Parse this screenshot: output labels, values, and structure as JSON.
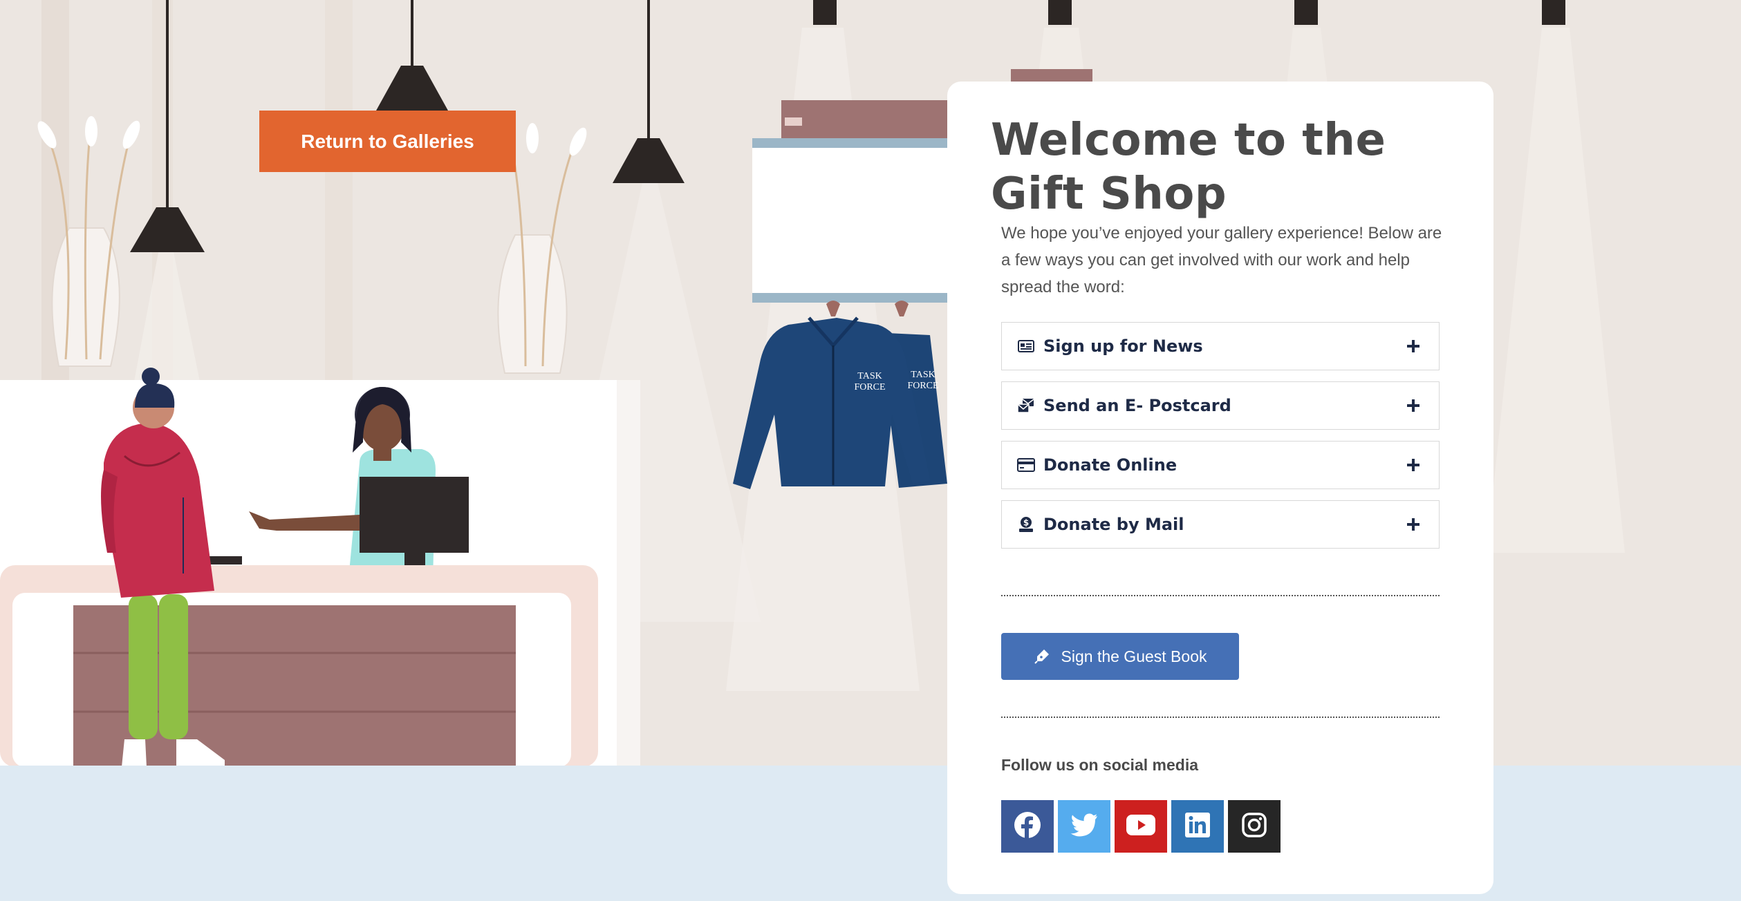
{
  "return_button": {
    "label": "Return to Galleries"
  },
  "panel": {
    "title_line1": "Welcome to the",
    "title_line2": "Gift Shop",
    "intro": "We hope you’ve enjoyed your gallery experience! Below are a few ways you can get involved with our work and help spread the word:",
    "accordion": [
      {
        "label": "Sign up for News",
        "icon": "newspaper-icon"
      },
      {
        "label": "Send an E- Postcard",
        "icon": "envelope-icon"
      },
      {
        "label": "Donate Online",
        "icon": "credit-card-icon"
      },
      {
        "label": "Donate by Mail",
        "icon": "donate-icon"
      }
    ],
    "guest_book_label": "Sign the Guest Book",
    "follow_label": "Follow us on social media",
    "social": [
      {
        "name": "facebook",
        "color": "#3b5998"
      },
      {
        "name": "twitter",
        "color": "#55acee"
      },
      {
        "name": "youtube",
        "color": "#cd201f"
      },
      {
        "name": "linkedin",
        "color": "#0077b5"
      },
      {
        "name": "instagram",
        "color": "#262626"
      }
    ]
  },
  "illustration": {
    "jacket_logo_line1": "TASK",
    "jacket_logo_line2": "FORCE"
  },
  "colors": {
    "accent_orange": "#e2652f",
    "button_blue": "#4570b6",
    "heading": "#4a4a4a",
    "floor": "#deeaf3",
    "wall": "#ece6e1"
  }
}
